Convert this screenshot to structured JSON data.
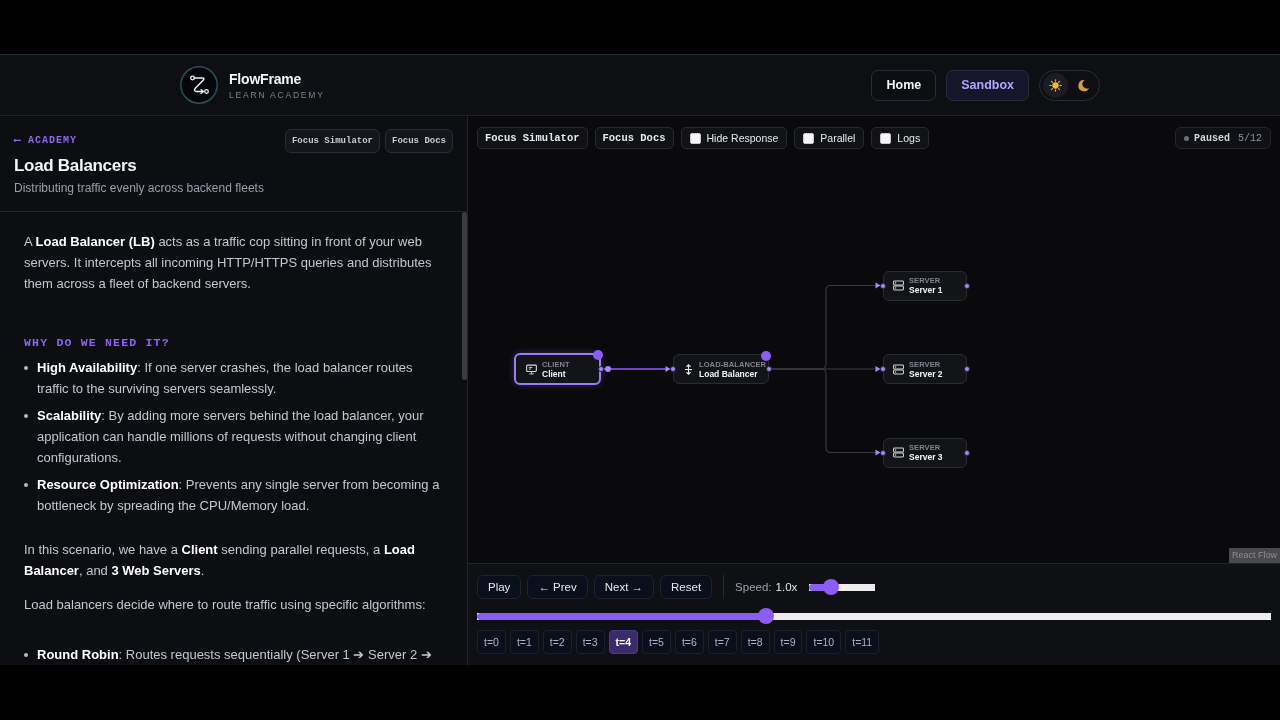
{
  "header": {
    "logo": {
      "name": "FlowFrame",
      "tagline": "LEARN ACADEMY"
    },
    "nav": [
      {
        "label": "Home",
        "selected": false
      },
      {
        "label": "Sandbox",
        "selected": true
      }
    ],
    "theme": [
      {
        "kind": "light",
        "selected": true
      },
      {
        "kind": "dark",
        "selected": false
      }
    ]
  },
  "lesson": {
    "back_link": "⟵ ACADEMY",
    "title": "Load Balancers",
    "subtitle": "Distributing traffic evenly across backend fleets",
    "focus_buttons": [
      "Focus Simulator",
      "Focus Docs"
    ],
    "article": [
      {
        "kind": "paragraph",
        "text": "A **Load Balancer (LB)** acts as a traffic cop sitting in front of your web servers. It intercepts all incoming HTTP/HTTPS queries and distributes them across a fleet of backend servers."
      },
      {
        "kind": "heading",
        "text": "WHY DO WE NEED IT?"
      },
      {
        "kind": "list",
        "items": [
          "**High Availability**: If one server crashes, the load balancer routes traffic to the surviving servers seamlessly.",
          "**Scalability**: By adding more servers behind the load balancer, your application can handle millions of requests without changing client configurations.",
          "**Resource Optimization**: Prevents any single server from becoming a bottleneck by spreading the CPU/Memory load."
        ]
      },
      {
        "kind": "paragraph",
        "text": "In this scenario, we have a **Client** sending parallel requests, a **Load Balancer**, and **3 Web Servers**."
      },
      {
        "kind": "paragraph",
        "text": "Load balancers decide where to route traffic using specific algorithms:"
      },
      {
        "kind": "list",
        "items": [
          "**Round Robin**: Routes requests sequentially (Server 1 ➔ Server 2 ➔"
        ]
      }
    ]
  },
  "simulator": {
    "toolbar": {
      "focus_buttons": [
        "Focus Simulator",
        "Focus Docs"
      ],
      "toggles": [
        {
          "label": "Hide Response",
          "checked": false
        },
        {
          "label": "Parallel",
          "checked": false
        },
        {
          "label": "Logs",
          "checked": false
        }
      ],
      "status": {
        "label": "Paused",
        "step": "5/12"
      }
    },
    "diagram": {
      "nodes": [
        {
          "kind": "client",
          "type": "CLIENT",
          "name": "Client",
          "selected": true,
          "active": true,
          "children": [
            {
              "kind": "load_balancer",
              "type": "LOAD-BALANCER",
              "name": "Load Balancer",
              "selected": false,
              "active": true,
              "link_active": true,
              "children": [
                {
                  "kind": "server",
                  "type": "SERVER",
                  "name": "Server 1",
                  "selected": false,
                  "active": false,
                  "link_active": false
                },
                {
                  "kind": "server",
                  "type": "SERVER",
                  "name": "Server 2",
                  "selected": false,
                  "active": false,
                  "link_active": false
                },
                {
                  "kind": "server",
                  "type": "SERVER",
                  "name": "Server 3",
                  "selected": false,
                  "active": false,
                  "link_active": false
                }
              ]
            }
          ]
        }
      ],
      "attribution": "React Flow"
    },
    "controls": {
      "buttons": [
        "Play",
        "← Prev",
        "Next →",
        "Reset"
      ],
      "speed": {
        "label": "Speed:",
        "value": "1.0x",
        "level": 0.33
      },
      "timeline": {
        "level": 0.364
      },
      "steps": [
        {
          "label": "t=0",
          "selected": false
        },
        {
          "label": "t=1",
          "selected": false
        },
        {
          "label": "t=2",
          "selected": false
        },
        {
          "label": "t=3",
          "selected": false
        },
        {
          "label": "t=4",
          "selected": true
        },
        {
          "label": "t=5",
          "selected": false
        },
        {
          "label": "t=6",
          "selected": false
        },
        {
          "label": "t=7",
          "selected": false
        },
        {
          "label": "t=8",
          "selected": false
        },
        {
          "label": "t=9",
          "selected": false
        },
        {
          "label": "t=10",
          "selected": false
        },
        {
          "label": "t=11",
          "selected": false
        }
      ]
    }
  }
}
